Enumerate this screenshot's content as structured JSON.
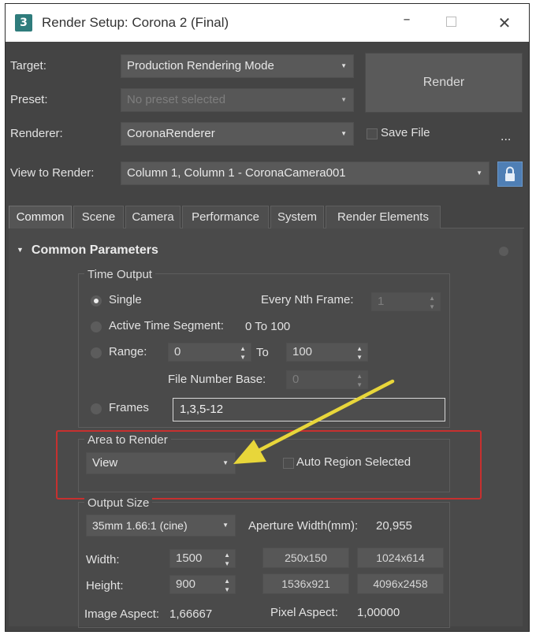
{
  "window": {
    "app_icon": "3",
    "title": "Render Setup: Corona 2 (Final)"
  },
  "header": {
    "target_label": "Target:",
    "target_value": "Production Rendering Mode",
    "preset_label": "Preset:",
    "preset_value": "No preset selected",
    "renderer_label": "Renderer:",
    "renderer_value": "CoronaRenderer",
    "view_label": "View to Render:",
    "view_value": "Column 1, Column 1 - CoronaCamera001",
    "render_button": "Render",
    "save_file_label": "Save File",
    "more_label": "..."
  },
  "tabs": [
    {
      "label": "Common",
      "active": true
    },
    {
      "label": "Scene",
      "active": false
    },
    {
      "label": "Camera",
      "active": false
    },
    {
      "label": "Performance",
      "active": false
    },
    {
      "label": "System",
      "active": false
    },
    {
      "label": "Render Elements",
      "active": false
    }
  ],
  "rollout": {
    "title": "Common Parameters"
  },
  "time_output": {
    "title": "Time Output",
    "single_label": "Single",
    "every_nth_label": "Every Nth Frame:",
    "every_nth_value": "1",
    "active_segment_label": "Active Time Segment:",
    "active_segment_value": "0 To 100",
    "range_label": "Range:",
    "range_from": "0",
    "range_to_label": "To",
    "range_to": "100",
    "file_number_base_label": "File Number Base:",
    "file_number_base_value": "0",
    "frames_label": "Frames",
    "frames_value": "1,3,5-12",
    "selected": "Single"
  },
  "area_to_render": {
    "title": "Area to Render",
    "value": "View",
    "auto_region_label": "Auto Region Selected"
  },
  "output_size": {
    "title": "Output Size",
    "preset_value": "35mm 1.66:1 (cine)",
    "aperture_label": "Aperture Width(mm):",
    "aperture_value": "20,955",
    "width_label": "Width:",
    "width_value": "1500",
    "height_label": "Height:",
    "height_value": "900",
    "presets": [
      "250x150",
      "1024x614",
      "1536x921",
      "4096x2458"
    ],
    "image_aspect_label": "Image Aspect:",
    "image_aspect_value": "1,66667",
    "pixel_aspect_label": "Pixel Aspect:",
    "pixel_aspect_value": "1,00000"
  },
  "colors": {
    "panel_bg": "#444444",
    "highlight_border": "#c7302f",
    "annotation_arrow": "#e8d63a",
    "lock_button": "#4f7fb5"
  }
}
